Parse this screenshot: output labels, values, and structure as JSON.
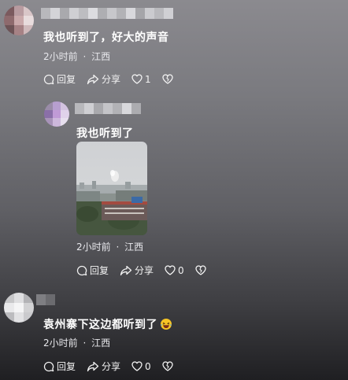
{
  "comments": [
    {
      "text": "我也听到了，好大的声音",
      "time": "2小时前",
      "location": "江西",
      "reply_label": "回复",
      "share_label": "分享",
      "like_count": "1"
    },
    {
      "text": "我也听到了",
      "time": "2小时前",
      "location": "江西",
      "reply_label": "回复",
      "share_label": "分享",
      "like_count": "0"
    },
    {
      "text": "袁州寨下这边都听到了",
      "time": "2小时前",
      "location": "江西",
      "reply_label": "回复",
      "share_label": "分享",
      "like_count": "0"
    }
  ],
  "separator": "·",
  "icons": {
    "reply": "comment-bubble-icon",
    "share": "share-arrow-icon",
    "like": "heart-icon",
    "dislike": "broken-heart-icon",
    "emoji": "laughing-crying-emoji-icon"
  }
}
